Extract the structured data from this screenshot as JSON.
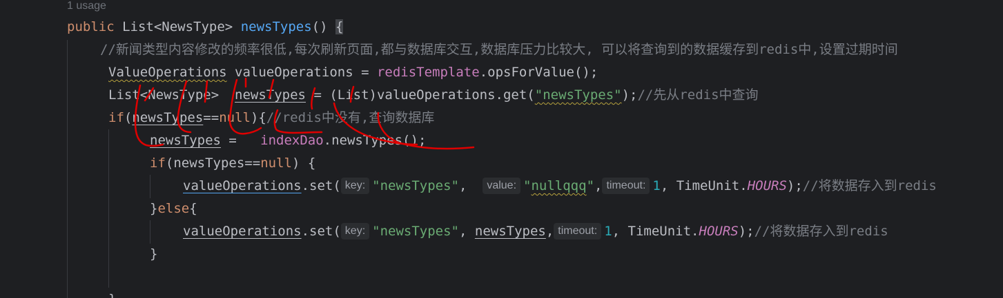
{
  "usage_hint": "1 usage",
  "code": {
    "l1": {
      "kw": "public",
      "type": "List<NewsType>",
      "fn": "newsTypes",
      "paren": "()",
      "brace": "{"
    },
    "l2": {
      "comment": "//新闻类型内容修改的频率很低,每次刷新页面,都与数据库交互,数据库压力比较大, 可以将查询到的数据缓存到redis中,设置过期时间"
    },
    "l3": {
      "type": "ValueOperations",
      "var": "valueOperations",
      "eq": " = ",
      "field": "redisTemplate",
      "rest": ".opsForValue();"
    },
    "l4": {
      "type": "List<NewsType>",
      "var": "newsTypes",
      "eq": " = (List)",
      "obj": "valueOperations",
      "call": ".get(",
      "str": "\"newsTypes\"",
      "end": ");",
      "comment": "//先从redis中查询"
    },
    "l5": {
      "kw": "if",
      "open": "(",
      "var": "newsTypes",
      "op": "==",
      "null": "null",
      "close": "){",
      "comment": "//redis中没有,查询数据库"
    },
    "l6": {
      "var": "newsTypes",
      "eq": " =   ",
      "field": "indexDao",
      "rest": ".newsTypes();"
    },
    "l7": {
      "kw": "if",
      "open": "(",
      "var": "newsTypes",
      "op": "==",
      "null": "null",
      "close": ") {"
    },
    "l8": {
      "obj": "valueOperations",
      "call": ".set(",
      "hint_key": "key:",
      "str1": "\"newsTypes\"",
      "comma1": ", ",
      "hint_value": "value:",
      "str2_a": "\"",
      "str2_b": "nullqqq",
      "str2_c": "\"",
      "comma2": ",",
      "hint_timeout": "timeout:",
      "num": "1",
      "comma3": ", ",
      "cls": "TimeUnit.",
      "const": "HOURS",
      "end": ");",
      "comment": "//将数据存入到redis"
    },
    "l9": {
      "brace": "}",
      "kw": "else",
      "open": "{"
    },
    "l10": {
      "obj": "valueOperations",
      "call": ".set(",
      "hint_key": "key:",
      "str1": "\"newsTypes\"",
      "comma1": ", ",
      "var": "newsTypes",
      "comma2": ",",
      "hint_timeout": "timeout:",
      "num": "1",
      "comma3": ", ",
      "cls": "TimeUnit.",
      "const": "HOURS",
      "end": ");",
      "comment": "//将数据存入到redis"
    },
    "l11": {
      "brace": "}"
    },
    "l13": {
      "brace": "}"
    }
  },
  "colors": {
    "background": "#1e1f22",
    "keyword": "#cf8e6d",
    "function": "#56a8f5",
    "string": "#6aab73",
    "number": "#2aacb8",
    "field": "#c77dbb",
    "comment": "#7a7e85",
    "annotation_ink": "#e00000"
  }
}
